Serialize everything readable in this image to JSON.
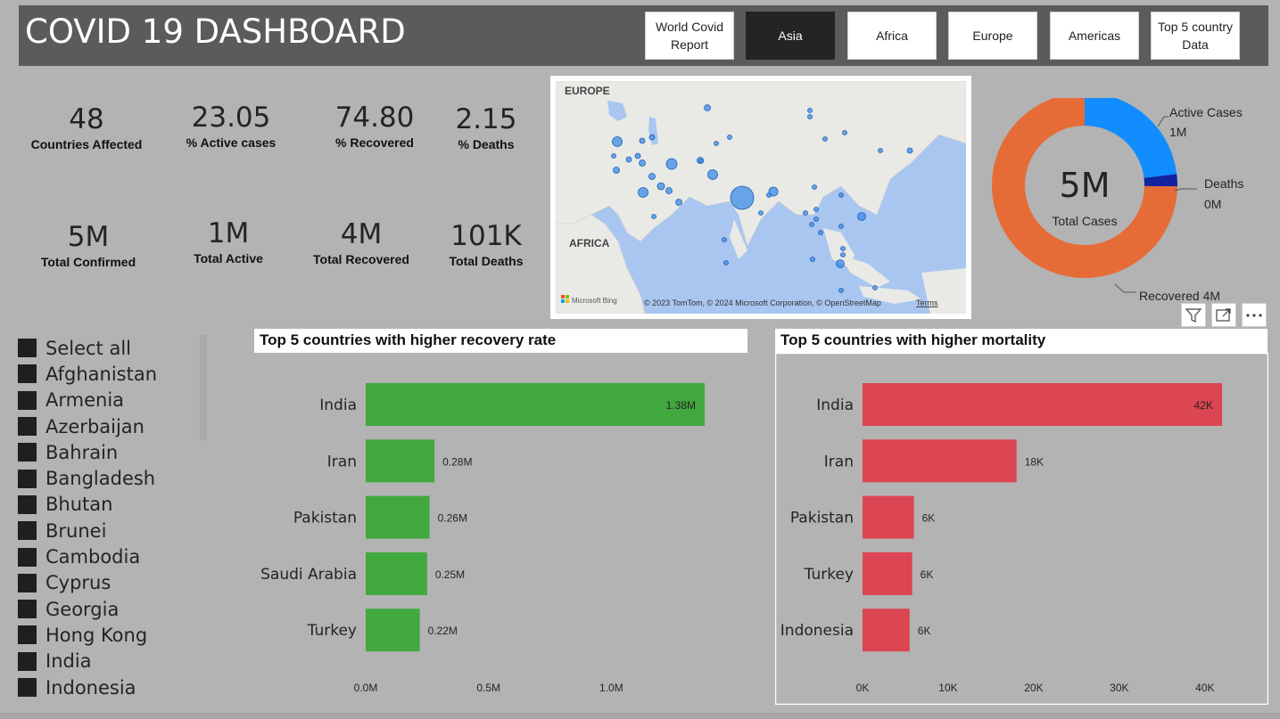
{
  "header": {
    "title": "COVID 19 DASHBOARD",
    "nav": [
      "World Covid Report",
      "Asia",
      "Africa",
      "Europe",
      "Americas",
      "Top 5 country Data"
    ],
    "active": "Asia"
  },
  "kpis": {
    "countries_affected": {
      "value": "48",
      "label": "Countries Affected"
    },
    "pct_active": {
      "value": "23.05",
      "label": "% Active cases"
    },
    "pct_recovered": {
      "value": "74.80",
      "label": "% Recovered"
    },
    "pct_deaths": {
      "value": "2.15",
      "label": "% Deaths"
    },
    "total_confirmed": {
      "value": "5M",
      "label": "Total Confirmed"
    },
    "total_active": {
      "value": "1M",
      "label": "Total Active"
    },
    "total_recovered": {
      "value": "4M",
      "label": "Total Recovered"
    },
    "total_deaths": {
      "value": "101K",
      "label": "Total Deaths"
    }
  },
  "map": {
    "label_europe": "EUROPE",
    "label_africa": "AFRICA",
    "attribution": "© 2023 TomTom, © 2024 Microsoft Corporation, © OpenStreetMap",
    "terms": "Terms",
    "logo": "Microsoft Bing"
  },
  "donut": {
    "center_value": "5M",
    "center_label": "Total Cases",
    "slices": [
      {
        "name": "Active Cases",
        "label": "1M",
        "value": 23.05,
        "color": "#118dff"
      },
      {
        "name": "Deaths",
        "label": "0M",
        "value": 2.15,
        "color": "#12239e"
      },
      {
        "name": "Recovered",
        "label": "4M",
        "value": 74.8,
        "color": "#e66c37"
      }
    ]
  },
  "slicer": {
    "items": [
      "Select all",
      "Afghanistan",
      "Armenia",
      "Azerbaijan",
      "Bahrain",
      "Bangladesh",
      "Bhutan",
      "Brunei",
      "Cambodia",
      "Cyprus",
      "Georgia",
      "Hong Kong",
      "India",
      "Indonesia"
    ]
  },
  "chart_data": [
    {
      "type": "bar",
      "title": "Top 5 countries with higher recovery rate",
      "categories": [
        "India",
        "Iran",
        "Pakistan",
        "Saudi Arabia",
        "Turkey"
      ],
      "values": [
        1.38,
        0.28,
        0.26,
        0.25,
        0.22
      ],
      "data_labels": [
        "1.38M",
        "0.28M",
        "0.26M",
        "0.25M",
        "0.22M"
      ],
      "unit": "M",
      "xlim": [
        0,
        1.38
      ],
      "x_ticks": [
        "0.0M",
        "0.5M",
        "1.0M"
      ],
      "x_tick_values": [
        0,
        0.5,
        1.0
      ],
      "color": "#41a83f"
    },
    {
      "type": "bar",
      "title": "Top 5 countries with higher mortality",
      "categories": [
        "India",
        "Iran",
        "Pakistan",
        "Turkey",
        "Indonesia"
      ],
      "values": [
        42,
        18,
        6,
        5.8,
        5.5
      ],
      "data_labels": [
        "42K",
        "18K",
        "6K",
        "6K",
        "6K"
      ],
      "unit": "K",
      "xlim": [
        0,
        42
      ],
      "x_ticks": [
        "0K",
        "10K",
        "20K",
        "30K",
        "40K"
      ],
      "x_tick_values": [
        0,
        10,
        20,
        30,
        40
      ],
      "color": "#dc4552"
    }
  ]
}
